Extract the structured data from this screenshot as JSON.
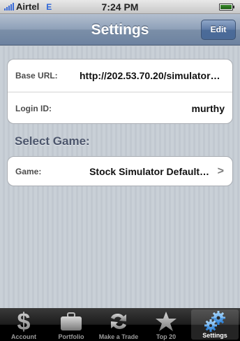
{
  "status_bar": {
    "carrier": "Airtel",
    "network_type": "E",
    "time": "7:24 PM"
  },
  "nav_bar": {
    "title": "Settings",
    "edit_label": "Edit"
  },
  "settings": {
    "rows": [
      {
        "label": "Base URL:",
        "value": "http://202.53.70.20/simulator…"
      },
      {
        "label": "Login ID:",
        "value": "murthy"
      }
    ],
    "section_title": "Select Game:",
    "game_row": {
      "label": "Game:",
      "value": "Stock Simulator Default…"
    }
  },
  "tab_bar": {
    "tabs": [
      {
        "label": "Account",
        "icon": "dollar-icon"
      },
      {
        "label": "Portfolio",
        "icon": "briefcase-icon"
      },
      {
        "label": "Make a Trade",
        "icon": "trade-arrows-icon"
      },
      {
        "label": "Top 20",
        "icon": "star-icon"
      },
      {
        "label": "Settings",
        "icon": "gears-icon",
        "active": true
      }
    ]
  },
  "colors": {
    "nav_bar": "#7b8fa8",
    "background": "#c5ccd4",
    "network_type": "#2d66d9",
    "section_title": "#4c566c"
  }
}
